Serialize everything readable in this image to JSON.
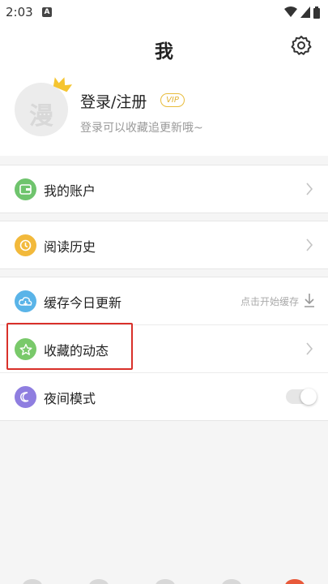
{
  "status": {
    "time": "2:03",
    "notif": "A"
  },
  "header": {
    "title": "我"
  },
  "profile": {
    "avatar_char": "漫",
    "login": "登录/注册",
    "vip": "VIP",
    "subtitle": "登录可以收藏追更新哦~"
  },
  "menu": {
    "account": "我的账户",
    "history": "阅读历史",
    "cache": "缓存今日更新",
    "cache_hint": "点击开始缓存",
    "favorites": "收藏的动态",
    "night": "夜间模式"
  },
  "colors": {
    "account": "#6fc46d",
    "history": "#f2b93b",
    "cache": "#5ab4e8",
    "favorites": "#79c96a",
    "night": "#8f7ee0",
    "highlight": "#d9302a",
    "vip": "#e2b232"
  }
}
